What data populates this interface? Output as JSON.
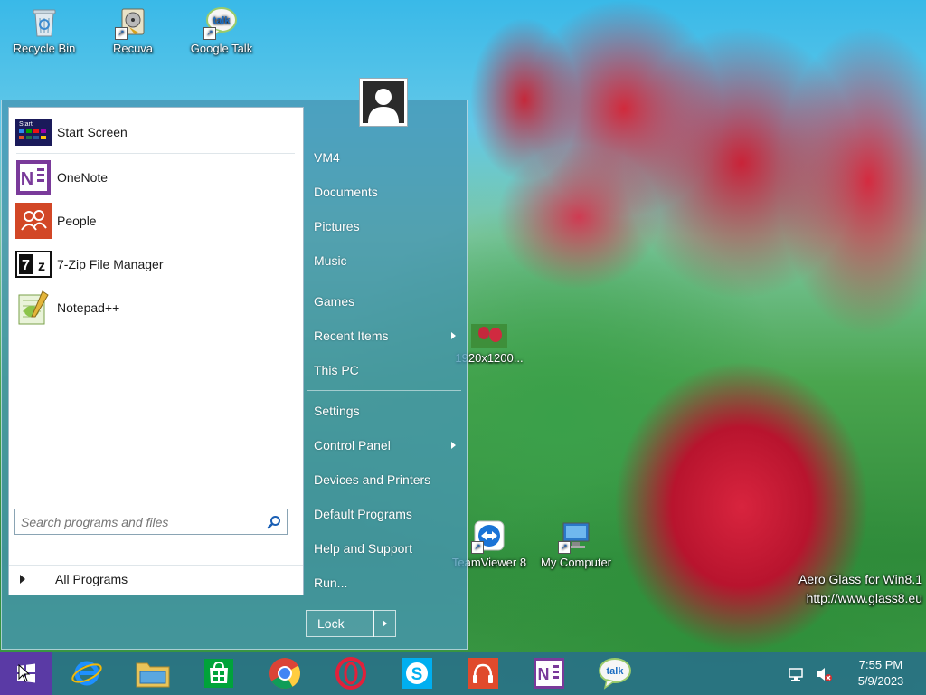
{
  "desktop": {
    "icons": [
      {
        "label": "Recycle Bin"
      },
      {
        "label": "Recuva"
      },
      {
        "label": "Google Talk"
      },
      {
        "label": "1920x1200..."
      },
      {
        "label": "TeamViewer 8"
      },
      {
        "label": "My Computer"
      }
    ],
    "watermark": {
      "line1": "Aero Glass for Win8.1",
      "line2": "http://www.glass8.eu"
    }
  },
  "start_menu": {
    "programs": [
      {
        "label": "Start Screen",
        "icon": "start-screen-icon"
      },
      {
        "label": "OneNote",
        "icon": "onenote-icon"
      },
      {
        "label": "People",
        "icon": "people-icon"
      },
      {
        "label": "7-Zip File Manager",
        "icon": "7zip-icon"
      },
      {
        "label": "Notepad++",
        "icon": "notepadpp-icon"
      }
    ],
    "all_programs": "All Programs",
    "search_placeholder": "Search programs and files",
    "right_items": [
      {
        "label": "VM4"
      },
      {
        "label": "Documents"
      },
      {
        "label": "Pictures"
      },
      {
        "label": "Music"
      },
      {
        "label": "Games"
      },
      {
        "label": "Recent Items",
        "submenu": true
      },
      {
        "label": "This PC"
      },
      {
        "label": "Settings"
      },
      {
        "label": "Control Panel",
        "submenu": true
      },
      {
        "label": "Devices and Printers"
      },
      {
        "label": "Default Programs"
      },
      {
        "label": "Help and Support"
      },
      {
        "label": "Run..."
      }
    ],
    "lock_label": "Lock"
  },
  "taskbar": {
    "pinned": [
      "internet-explorer-icon",
      "file-explorer-icon",
      "store-icon",
      "chrome-icon",
      "opera-icon",
      "skype-icon",
      "music-app-icon",
      "onenote-icon",
      "google-talk-icon"
    ],
    "clock": {
      "time": "7:55 PM",
      "date": "5/9/2023"
    }
  },
  "colors": {
    "start_button": "#5a3aa5",
    "taskbar": "#286e8c",
    "menu_glass": "#4696b4"
  }
}
